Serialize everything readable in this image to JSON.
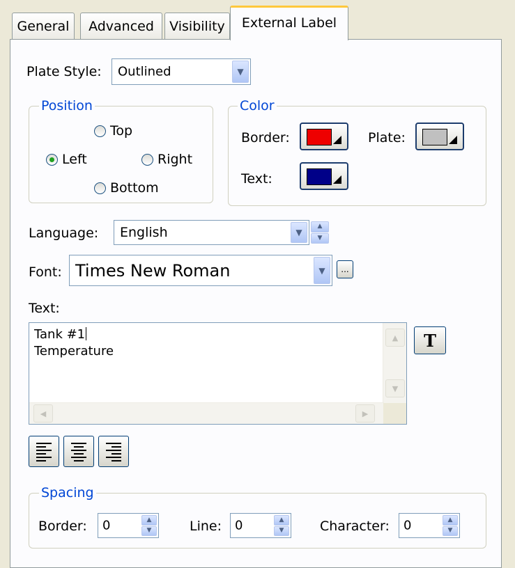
{
  "tabs": [
    "General",
    "Advanced",
    "Visibility",
    "External Label"
  ],
  "plate_style": {
    "label": "Plate Style:",
    "value": "Outlined"
  },
  "position": {
    "legend": "Position",
    "options": [
      "Top",
      "Left",
      "Right",
      "Bottom"
    ],
    "selected": "Left"
  },
  "color": {
    "legend": "Color",
    "border_label": "Border:",
    "plate_label": "Plate:",
    "text_label": "Text:",
    "border_color": "#ee0000",
    "plate_color": "#c0c0c0",
    "text_color": "#000088"
  },
  "language": {
    "label": "Language:",
    "value": "English"
  },
  "font": {
    "label": "Font:",
    "value": "Times New Roman",
    "browse_label": "..."
  },
  "text": {
    "label": "Text:",
    "lines": [
      "Tank #1",
      "Temperature"
    ],
    "format_button": "T"
  },
  "alignment_icons": [
    "align-left-icon",
    "align-center-icon",
    "align-right-icon"
  ],
  "spacing": {
    "legend": "Spacing",
    "border_label": "Border:",
    "border_value": "0",
    "line_label": "Line:",
    "line_value": "0",
    "character_label": "Character:",
    "character_value": "0"
  }
}
